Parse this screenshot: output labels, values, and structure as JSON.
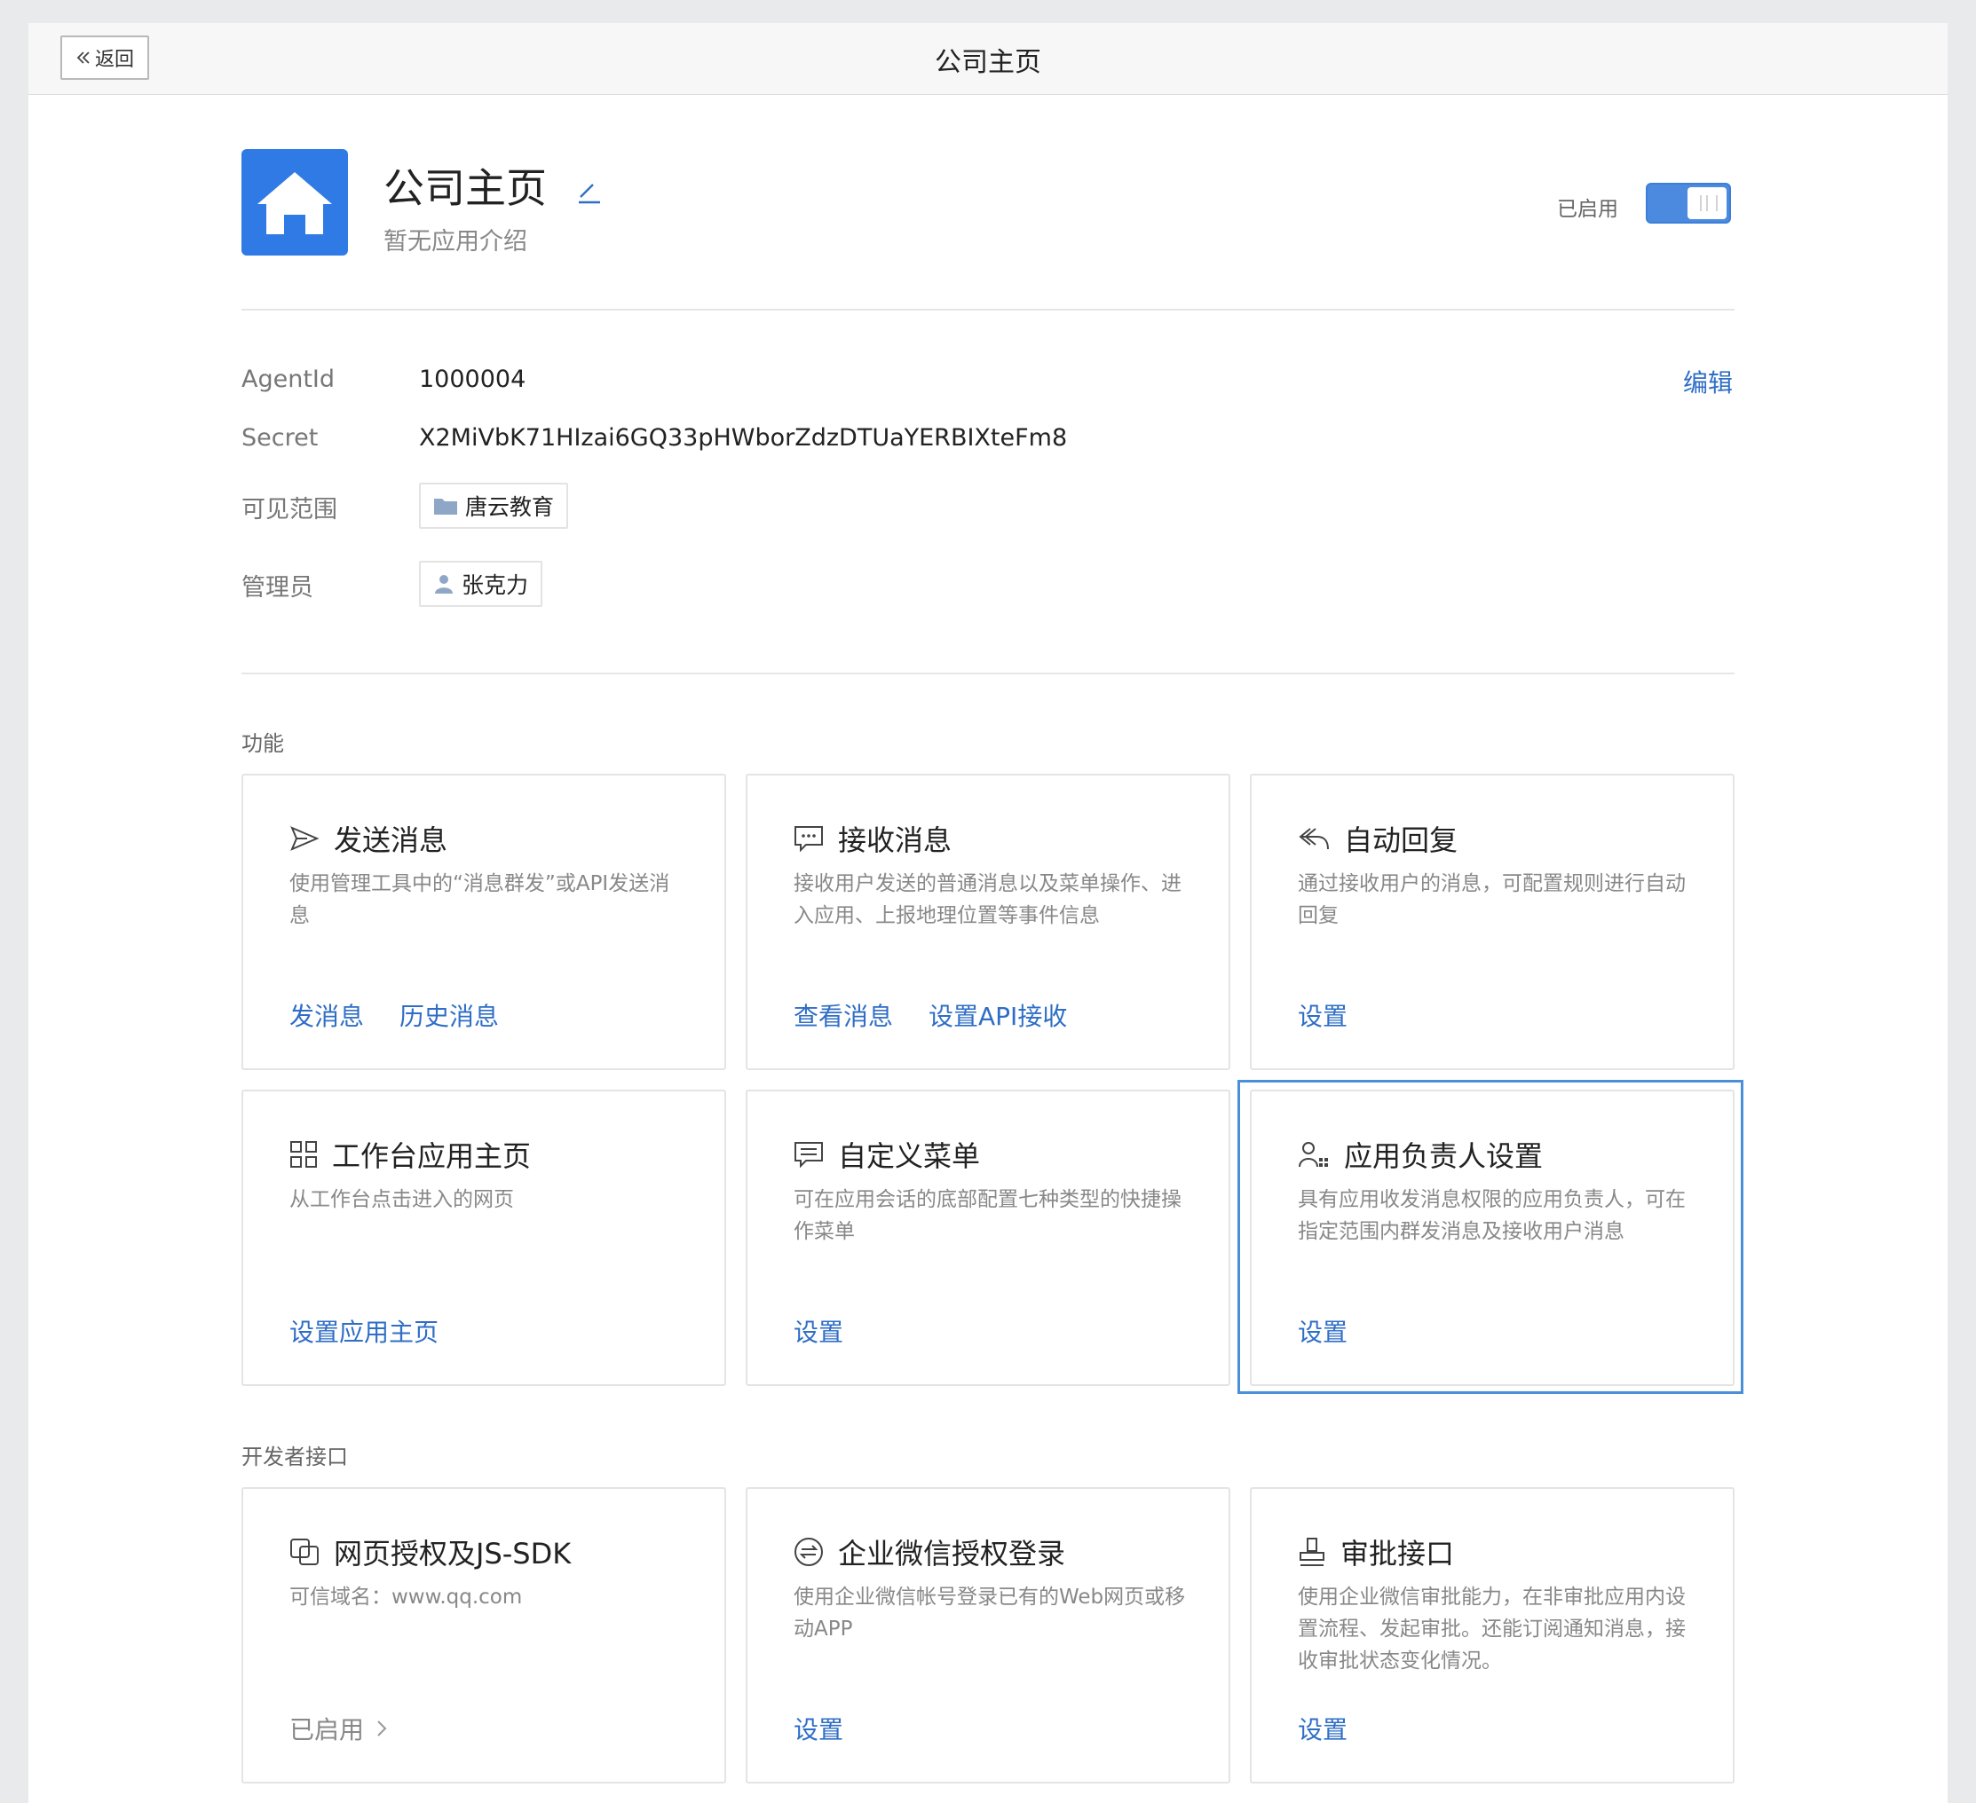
{
  "topbar": {
    "back_label": "返回",
    "title": "公司主页"
  },
  "app": {
    "name": "公司主页",
    "description": "暂无应用介绍",
    "enabled_label": "已启用",
    "enabled": true,
    "icon": "house-icon",
    "icon_color": "#2f7ae5"
  },
  "info": {
    "agent_label": "AgentId",
    "agent_value": "1000004",
    "secret_label": "Secret",
    "secret_value": "X2MiVbK71HIzai6GQ33pHWborZdzDTUaYERBIXteFm8",
    "edit_label": "编辑",
    "scope_label": "可见范围",
    "scope_value": "唐云教育",
    "admin_label": "管理员",
    "admin_value": "张克力"
  },
  "functions": {
    "title": "功能",
    "cards": [
      {
        "icon": "send-icon",
        "title": "发送消息",
        "desc": "使用管理工具中的“消息群发”或API发送消息",
        "links": [
          "发消息",
          "历史消息"
        ]
      },
      {
        "icon": "chat-bubble-icon",
        "title": "接收消息",
        "desc": "接收用户发送的普通消息以及菜单操作、进入应用、上报地理位置等事件信息",
        "links": [
          "查看消息",
          "设置API接收"
        ]
      },
      {
        "icon": "reply-icon",
        "title": "自动回复",
        "desc": "通过接收用户的消息，可配置规则进行自动回复",
        "links": [
          "设置"
        ]
      },
      {
        "icon": "grid-icon",
        "title": "工作台应用主页",
        "desc": "从工作台点击进入的网页",
        "links": [
          "设置应用主页"
        ]
      },
      {
        "icon": "menu-icon",
        "title": "自定义菜单",
        "desc": "可在应用会话的底部配置七种类型的快捷操作菜单",
        "links": [
          "设置"
        ]
      },
      {
        "icon": "user-settings-icon",
        "title": "应用负责人设置",
        "desc": "具有应用收发消息权限的应用负责人，可在指定范围内群发消息及接收用户消息",
        "links": [
          "设置"
        ]
      }
    ]
  },
  "developer": {
    "title": "开发者接口",
    "cards": [
      {
        "icon": "copy-link-icon",
        "title": "网页授权及JS-SDK",
        "desc": "可信域名：www.qq.com",
        "status": "已启用"
      },
      {
        "icon": "wechat-login-icon",
        "title": "企业微信授权登录",
        "desc": "使用企业微信帐号登录已有的Web网页或移动APP",
        "links": [
          "设置"
        ]
      },
      {
        "icon": "stamp-icon",
        "title": "审批接口",
        "desc": "使用企业微信审批能力，在非审批应用内设置流程、发起审批。还能订阅通知消息，接收审批状态变化情况。",
        "links": [
          "设置"
        ]
      }
    ]
  },
  "colors": {
    "link": "#2f6ec6",
    "highlight": "#4a90d9",
    "toggle": "#4c8ae0"
  }
}
